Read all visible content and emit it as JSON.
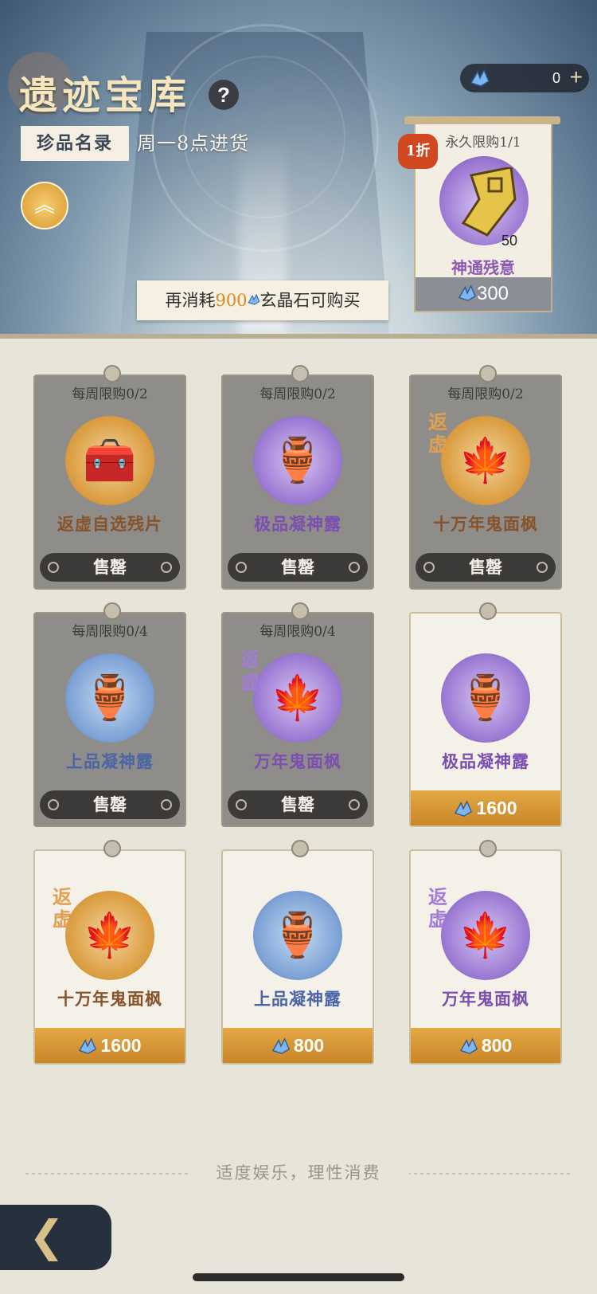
{
  "header": {
    "title": "遗迹宝库",
    "help": "?",
    "tag": "珍品名录",
    "restock": "周一8点进货",
    "condition_prefix": "再消耗",
    "condition_num": "900",
    "condition_suffix": "玄晶石可购买"
  },
  "currency": {
    "amount": "0",
    "plus": "+"
  },
  "featured": {
    "limit": "永久限购1/1",
    "discount": "1折",
    "qty": "50",
    "name": "神通残意",
    "price": "300"
  },
  "cards": [
    {
      "limit": "每周限购0/2",
      "name": "返虚自选残片",
      "status": "售罄"
    },
    {
      "limit": "每周限购0/2",
      "name": "极品凝神露",
      "status": "售罄"
    },
    {
      "limit": "每周限购0/2",
      "name": "十万年鬼面枫",
      "status": "售罄",
      "origin": "返虚"
    },
    {
      "limit": "每周限购0/4",
      "name": "上品凝神露",
      "status": "售罄"
    },
    {
      "limit": "每周限购0/4",
      "name": "万年鬼面枫",
      "status": "售罄",
      "origin": "返虚"
    },
    {
      "name": "极品凝神露",
      "price": "1600"
    },
    {
      "name": "十万年鬼面枫",
      "price": "1600",
      "origin": "返虚"
    },
    {
      "name": "上品凝神露",
      "price": "800"
    },
    {
      "name": "万年鬼面枫",
      "price": "800",
      "origin": "返虚"
    }
  ],
  "footer": {
    "text": "适度娱乐，理性消费"
  },
  "colors": {
    "accent_gold": "#d88a1c",
    "discount_red": "#d1471f"
  }
}
